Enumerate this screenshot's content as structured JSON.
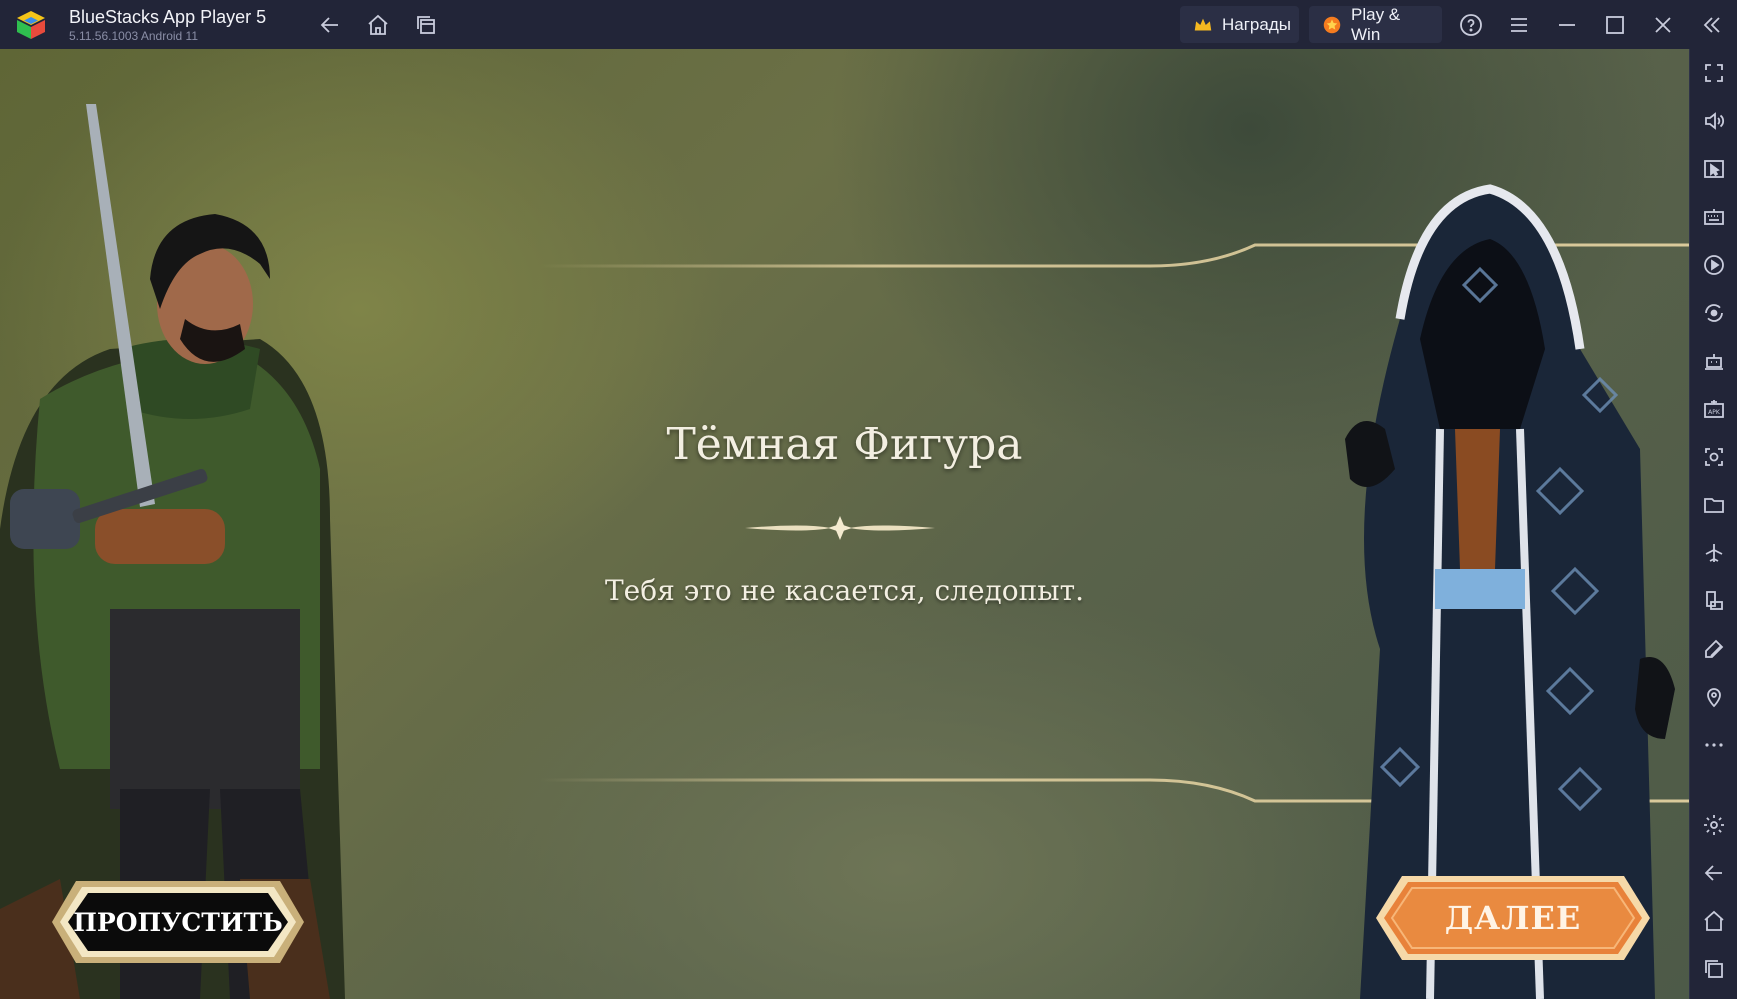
{
  "window": {
    "app_title": "BlueStacks App Player 5",
    "version": "5.11.56.1003  Android 11",
    "rewards_label": "Награды",
    "playwin_label": "Play & Win"
  },
  "titlebar_icons": [
    "back-icon",
    "home-icon",
    "multi-instance-icon",
    "help-icon",
    "menu-icon",
    "minimize-icon",
    "maximize-icon",
    "close-icon",
    "collapse-sidebar-icon"
  ],
  "sidebar_icons": [
    "fullscreen-icon",
    "volume-icon",
    "media-icon",
    "keyboard-icon",
    "macro-play-icon",
    "rotate-sync-icon",
    "bot-icon",
    "install-apk-icon",
    "screenshot-icon",
    "folder-icon",
    "airplane-mode-icon",
    "resize-icon",
    "eco-mode-icon",
    "location-icon",
    "more-icon",
    "settings-icon",
    "android-back-icon",
    "android-home-icon",
    "android-recents-icon"
  ],
  "dialog": {
    "speaker": "Тёмная Фигура",
    "text": "Тебя это не касается, следопыт."
  },
  "buttons": {
    "skip": "ПРОПУСТИТЬ",
    "next": "ДАЛЕЕ"
  },
  "colors": {
    "chrome_bg": "#222538",
    "next_button": "#e8823a",
    "skip_button": "#0b0b0b",
    "gold_trim": "#e9d6a4"
  }
}
